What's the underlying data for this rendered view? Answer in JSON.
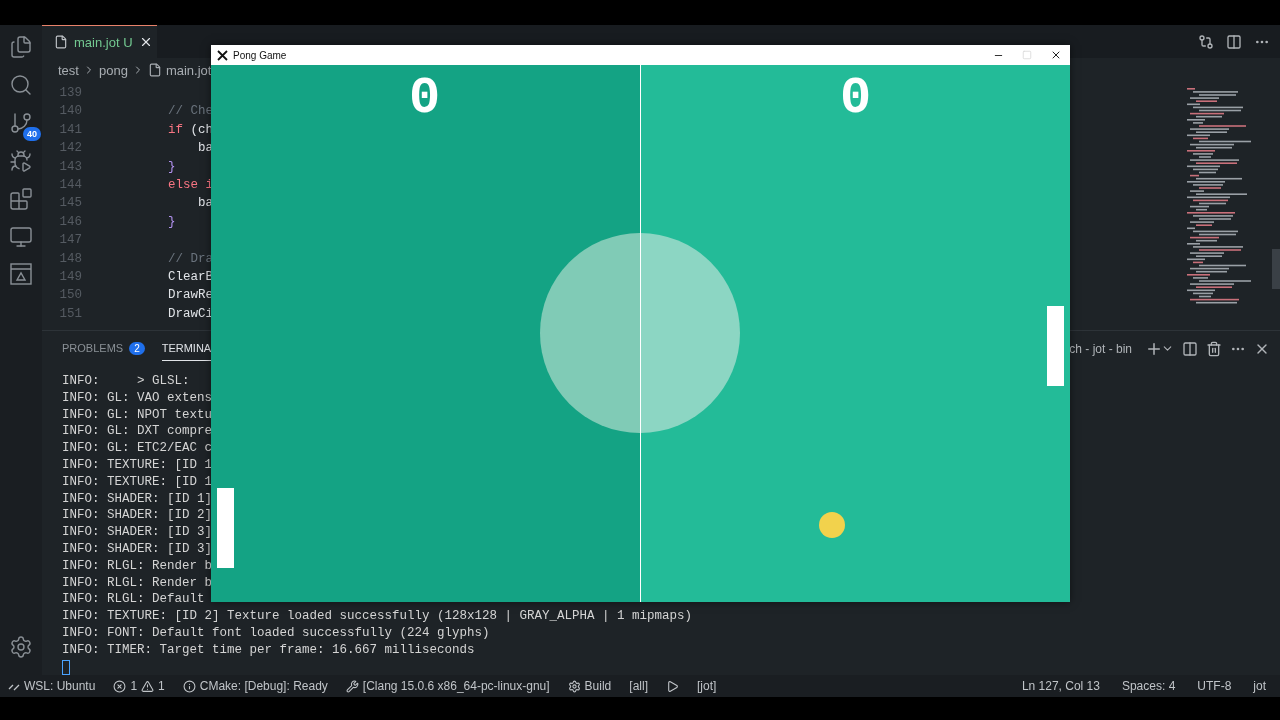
{
  "activity_bar": {
    "source_control_badge": "40"
  },
  "editor": {
    "tab": {
      "label": "main.jot",
      "status": "U",
      "selected": true
    },
    "breadcrumb": [
      "test",
      "pong",
      "main.jot"
    ],
    "lines": [
      {
        "number": "139"
      },
      {
        "number": "140",
        "tokens": [
          {
            "text": "        // Che",
            "kind": "comment"
          }
        ]
      },
      {
        "number": "141",
        "tokens": [
          {
            "text": "        if",
            "kind": "keyword"
          },
          {
            "text": " (ch",
            "kind": "plain"
          }
        ]
      },
      {
        "number": "142",
        "tokens": [
          {
            "text": "            ba",
            "kind": "plain"
          }
        ]
      },
      {
        "number": "143",
        "tokens": [
          {
            "text": "        }",
            "kind": "brace"
          }
        ]
      },
      {
        "number": "144",
        "tokens": [
          {
            "text": "        else i",
            "kind": "keyword"
          }
        ]
      },
      {
        "number": "145",
        "tokens": [
          {
            "text": "            ba",
            "kind": "plain"
          }
        ]
      },
      {
        "number": "146",
        "tokens": [
          {
            "text": "        }",
            "kind": "brace"
          }
        ]
      },
      {
        "number": "147"
      },
      {
        "number": "148",
        "tokens": [
          {
            "text": "        // Dra",
            "kind": "comment"
          }
        ]
      },
      {
        "number": "149",
        "tokens": [
          {
            "text": "        ClearB",
            "kind": "plain"
          }
        ]
      },
      {
        "number": "150",
        "tokens": [
          {
            "text": "        DrawRe",
            "kind": "plain"
          }
        ]
      },
      {
        "number": "151",
        "tokens": [
          {
            "text": "        DrawCi",
            "kind": "plain"
          }
        ]
      }
    ]
  },
  "panel": {
    "tabs": [
      {
        "label": "PROBLEMS",
        "badge": "2",
        "selected": false
      },
      {
        "label": "TERMINA",
        "selected": true
      }
    ],
    "terminal_name": "ch - jot - bin",
    "lines": [
      "INFO:     > GLSL:",
      "INFO: GL: VAO extens",
      "INFO: GL: NPOT textu",
      "INFO: GL: DXT compre",
      "INFO: GL: ETC2/EAC c",
      "INFO: TEXTURE: [ID 1",
      "INFO: TEXTURE: [ID 1",
      "INFO: SHADER: [ID 1]",
      "INFO: SHADER: [ID 2]",
      "INFO: SHADER: [ID 3]",
      "INFO: SHADER: [ID 3]",
      "INFO: RLGL: Render b",
      "INFO: RLGL: Render b",
      "INFO: RLGL: Default",
      "INFO: TEXTURE: [ID 2] Texture loaded successfully (128x128 | GRAY_ALPHA | 1 mipmaps)",
      "INFO: FONT: Default font loaded successfully (224 glyphs)",
      "INFO: TIMER: Target time per frame: 16.667 milliseconds"
    ]
  },
  "status_bar": {
    "left": [
      {
        "kind": "remote",
        "text": "WSL: Ubuntu"
      },
      {
        "kind": "problems",
        "errors": "1",
        "warnings": "1"
      },
      {
        "kind": "info",
        "text": "CMake: [Debug]: Ready"
      },
      {
        "kind": "tools",
        "text": "[Clang 15.0.6 x86_64-pc-linux-gnu]"
      },
      {
        "kind": "gear",
        "text": "Build"
      },
      {
        "kind": "plain",
        "text": "[all]"
      },
      {
        "kind": "play"
      },
      {
        "kind": "plain",
        "text": "[jot]"
      }
    ],
    "right": [
      "Ln 127, Col 13",
      "Spaces: 4",
      "UTF-8",
      "jot"
    ]
  },
  "game_window": {
    "title": "Pong Game",
    "maximize_disabled": true,
    "scores": [
      "0",
      "0"
    ]
  }
}
